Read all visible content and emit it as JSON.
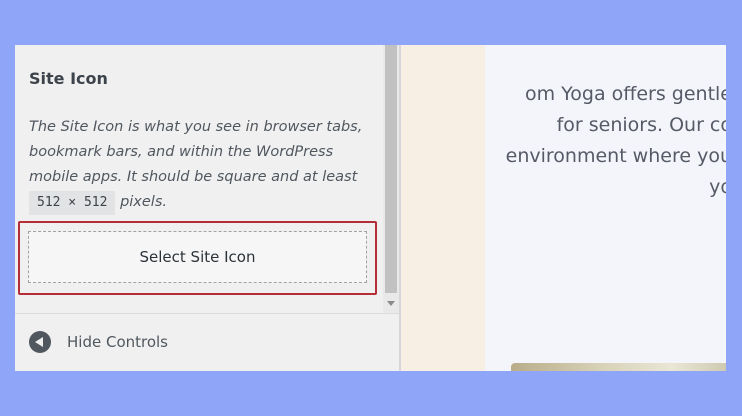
{
  "panel": {
    "title": "Site Icon",
    "description_before": "The Site Icon is what you see in browser tabs, bookmark bars, and within the WordPress mobile apps. It should be square and at least",
    "size_chip": "512 × 512",
    "description_after": "pixels.",
    "select_button_label": "Select Site Icon",
    "hide_controls_label": "Hide Controls",
    "hide_controls_icon": "arrow-left-circle-icon"
  },
  "preview": {
    "lines": [
      "om Yoga offers gentle",
      "for seniors. Our co",
      "environment where you",
      "yo"
    ]
  },
  "colors": {
    "background": "#8fa5f8",
    "highlight_border": "#b52d37",
    "panel_bg": "#f0f0f1",
    "preview_side_bg": "#f7efe4"
  }
}
